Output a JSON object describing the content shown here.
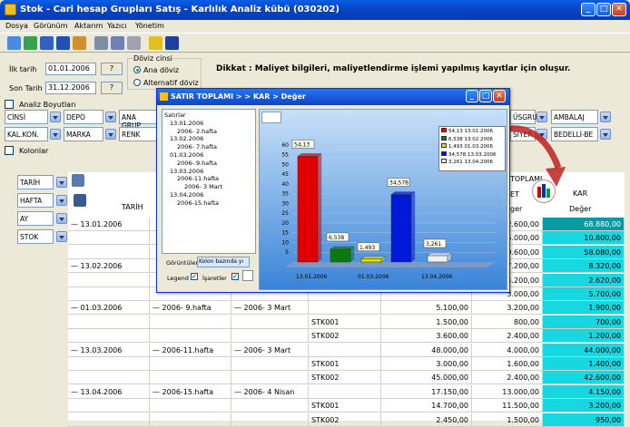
{
  "window": {
    "title": "Stok - Cari hesap Grupları Satış - Karlılık Analiz kübü (030202)"
  },
  "menu": [
    "Dosya",
    "Görünüm",
    "Aktarım",
    "Yazıcı",
    "Yönetim"
  ],
  "filters": {
    "ilk_tarih_label": "İlk tarih",
    "ilk_tarih": "01.01.2006",
    "son_tarih_label": "Son Tarih",
    "son_tarih": "31.12.2006",
    "doviz_label": "Döviz cinsi",
    "opt1": "Ana döviz",
    "opt2": "Alternatif döviz",
    "qmark": "?"
  },
  "notice": "Dikkat : Maliyet bilgileri, maliyetlendirme işlemi yapılmış kayıtlar için oluşur.",
  "analiz_label": "Analiz Boyutları",
  "kolonlar_label": "Kolonlar",
  "dims_row1": [
    "CİNSİ",
    "DEPO",
    "ANA GRUP",
    "",
    "ÜSGRUP",
    "AMBALAJ"
  ],
  "dims_row2": [
    "KAL.KON.",
    "MARKA",
    "RENK",
    "",
    "SİYER",
    "BEDELLİ-BE"
  ],
  "row_fields": [
    "TARİH",
    "HAFTA",
    "AY",
    "STOK"
  ],
  "grid": {
    "header_tarih": "TARİH",
    "header_toplam": "TOPLAMI",
    "header_ret": "ET",
    "header_kar": "KAR",
    "header_deger": "Değer",
    "header_ger": "ger",
    "rows": [
      {
        "tarih": "13.01.2006",
        "hafta": "",
        "gun": "",
        "stok": "",
        "c1": "",
        "c2": "2.600,00",
        "kar": "68.880,00",
        "hl": true
      },
      {
        "tarih": "",
        "hafta": "",
        "gun": "",
        "stok": "",
        "c1": "",
        "c2": "5.000,00",
        "kar": "10.800,00"
      },
      {
        "tarih": "",
        "hafta": "",
        "gun": "",
        "stok": "",
        "c1": "",
        "c2": "9.600,00",
        "kar": "58.080,00"
      },
      {
        "tarih": "13.02.2006",
        "hafta": "",
        "gun": "",
        "stok": "",
        "c1": "",
        "c2": "7.200,00",
        "kar": "8.320,00"
      },
      {
        "tarih": "",
        "hafta": "",
        "gun": "",
        "stok": "",
        "c1": "",
        "c2": "4.200,00",
        "kar": "2.620,00"
      },
      {
        "tarih": "",
        "hafta": "",
        "gun": "",
        "stok": "",
        "c1": "",
        "c2": "3.000,00",
        "kar": "5.700,00"
      },
      {
        "tarih": "01.03.2006",
        "hafta": "2006- 9.hafta",
        "gun": "2006- 3 Mart",
        "stok": "",
        "c1": "5.100,00",
        "c2": "3.200,00",
        "kar": "1.900,00"
      },
      {
        "tarih": "",
        "hafta": "",
        "gun": "",
        "stok": "STK001",
        "c1": "1.500,00",
        "c2": "800,00",
        "kar": "700,00"
      },
      {
        "tarih": "",
        "hafta": "",
        "gun": "",
        "stok": "STK002",
        "c1": "3.600,00",
        "c2": "2.400,00",
        "kar": "1.200,00"
      },
      {
        "tarih": "13.03.2006",
        "hafta": "2006-11.hafta",
        "gun": "2006- 3 Mart",
        "stok": "",
        "c1": "48.000,00",
        "c2": "4.000,00",
        "kar": "44.000,00"
      },
      {
        "tarih": "",
        "hafta": "",
        "gun": "",
        "stok": "STK001",
        "c1": "3.000,00",
        "c2": "1.600,00",
        "kar": "1.400,00"
      },
      {
        "tarih": "",
        "hafta": "",
        "gun": "",
        "stok": "STK002",
        "c1": "45.000,00",
        "c2": "2.400,00",
        "kar": "42.600,00"
      },
      {
        "tarih": "13.04.2006",
        "hafta": "2006-15.hafta",
        "gun": "2006- 4 Nisan",
        "stok": "",
        "c1": "17.150,00",
        "c2": "13.000,00",
        "kar": "4.150,00"
      },
      {
        "tarih": "",
        "hafta": "",
        "gun": "",
        "stok": "STK001",
        "c1": "14.700,00",
        "c2": "11.500,00",
        "kar": "3.200,00"
      },
      {
        "tarih": "",
        "hafta": "",
        "gun": "",
        "stok": "STK002",
        "c1": "2.450,00",
        "c2": "1.500,00",
        "kar": "950,00"
      }
    ]
  },
  "popup": {
    "title": "SATIR TOPLAMI > > KAR > Değer",
    "tree": [
      "Satırlar",
      "13.01.2006",
      "2006- 2.hafta",
      "13.02.2006",
      "2006- 7.hafta",
      "01.03.2006",
      "2006- 9.hafta",
      "13.03.2006",
      "2006-11.hafta",
      "2006- 3 Mart",
      "13.04.2006",
      "2006-15.hafta"
    ],
    "gorunum_label": "Görüntüler",
    "gorunum_value": "Kolon bazında yı",
    "legend_label": "Legend",
    "isaret_label": "İşaretler"
  },
  "chart_data": {
    "type": "bar",
    "categories": [
      "13.01.2006",
      "13.02.2006",
      "01.03.2006",
      "13.03.2006",
      "13.04.2006"
    ],
    "x_tick_labels": [
      "13.01.2006",
      "01.03.2006",
      "13.04.2006"
    ],
    "values": [
      54.13,
      6.538,
      1.493,
      34.578,
      3.261
    ],
    "data_labels": [
      "54,13",
      "6,538",
      "1,493",
      "34,578",
      "3,261"
    ],
    "legend": [
      "54,13 13.01.2006",
      "6,538 13.02.2006",
      "1,493 01.03.2006",
      "34,578 13.03.2006",
      "3,261 13.04.2006"
    ],
    "colors": [
      "#e00000",
      "#0a7a10",
      "#e8e000",
      "#0018d8",
      "#f0f0f0"
    ],
    "yticks": [
      5,
      10,
      15,
      20,
      25,
      30,
      35,
      40,
      45,
      50,
      55,
      60
    ],
    "ylim": [
      0,
      65
    ]
  }
}
